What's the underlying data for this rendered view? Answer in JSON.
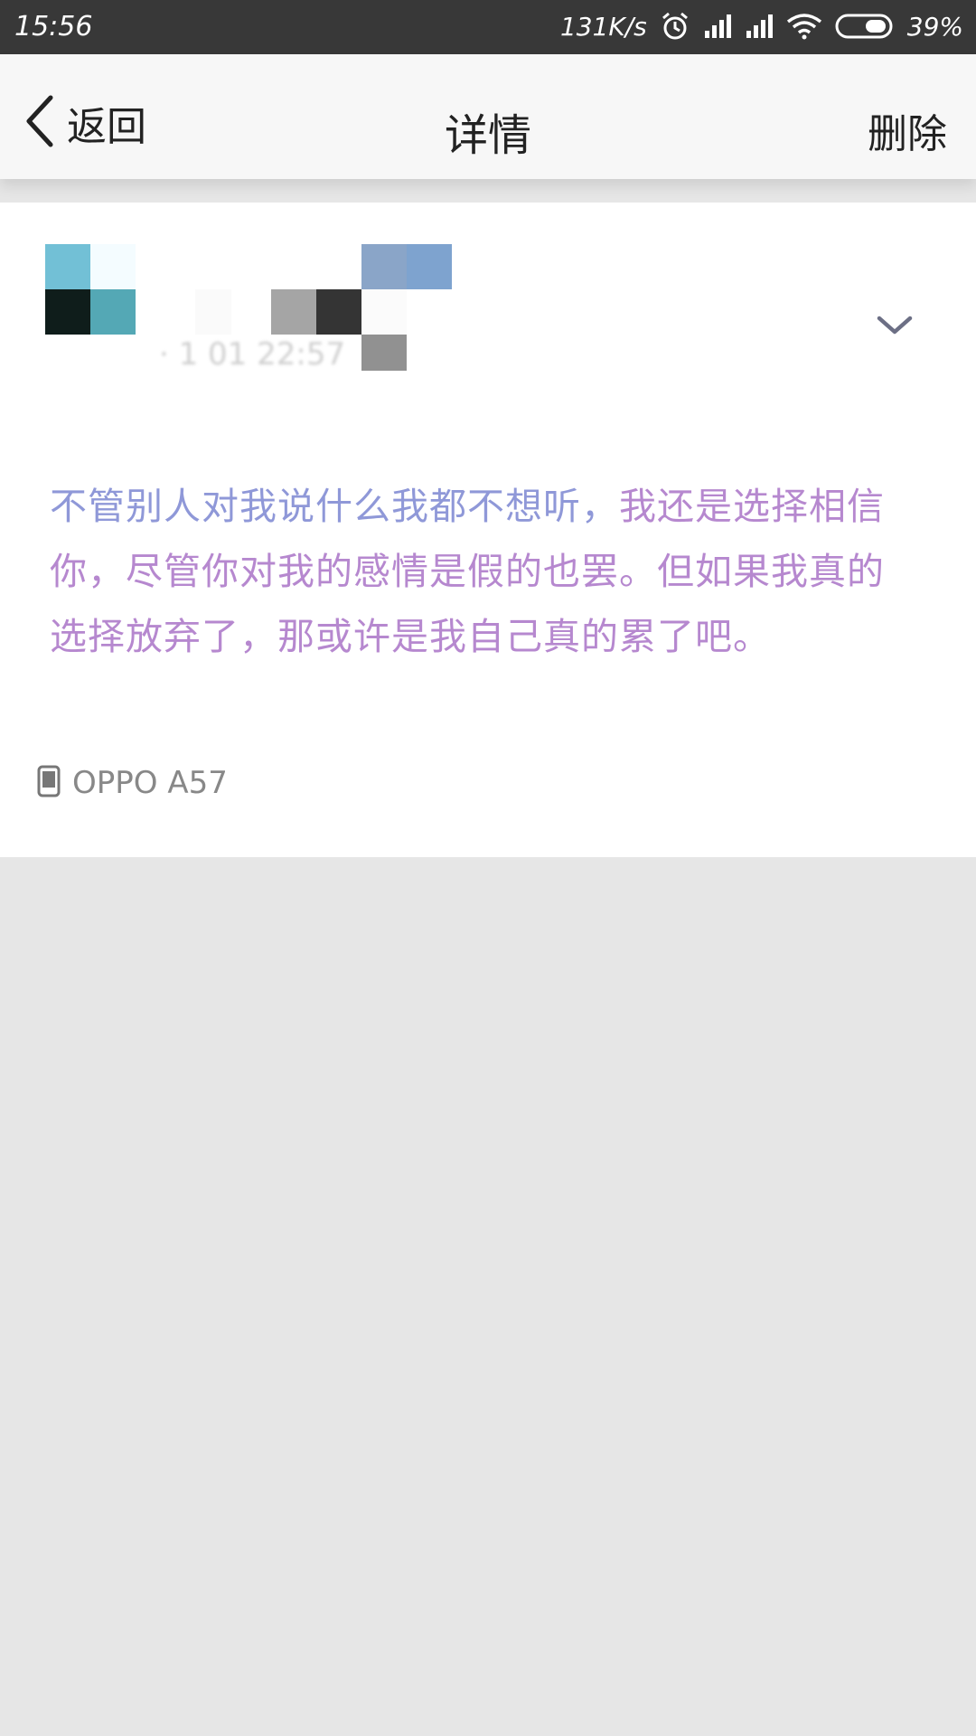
{
  "status_bar": {
    "time": "15:56",
    "net_speed": "131K/s",
    "battery": "39%",
    "icons": [
      "alarm-icon",
      "signal-icon",
      "signal-icon",
      "wifi-icon",
      "battery-icon"
    ]
  },
  "nav": {
    "back_label": "返回",
    "title": "详情",
    "delete_label": "删除"
  },
  "post": {
    "timestamp_partial": "· 1 01 22:57",
    "content_part1": "不管别人对我说什么我都不想听，",
    "content_part2": "我还是选择相信你，尽管你对我的感情是假的也罢。但如果我真的选择放弃了，那或许是我自己真的累了吧。",
    "device": "OPPO A57",
    "colors": {
      "text_start": "#8f98d8",
      "text_end": "#b688cf"
    }
  },
  "colors": {
    "status_bar_bg": "#383838",
    "nav_bg": "#f7f7f7",
    "card_bg": "#ffffff",
    "page_bg": "#e6e6e6"
  }
}
